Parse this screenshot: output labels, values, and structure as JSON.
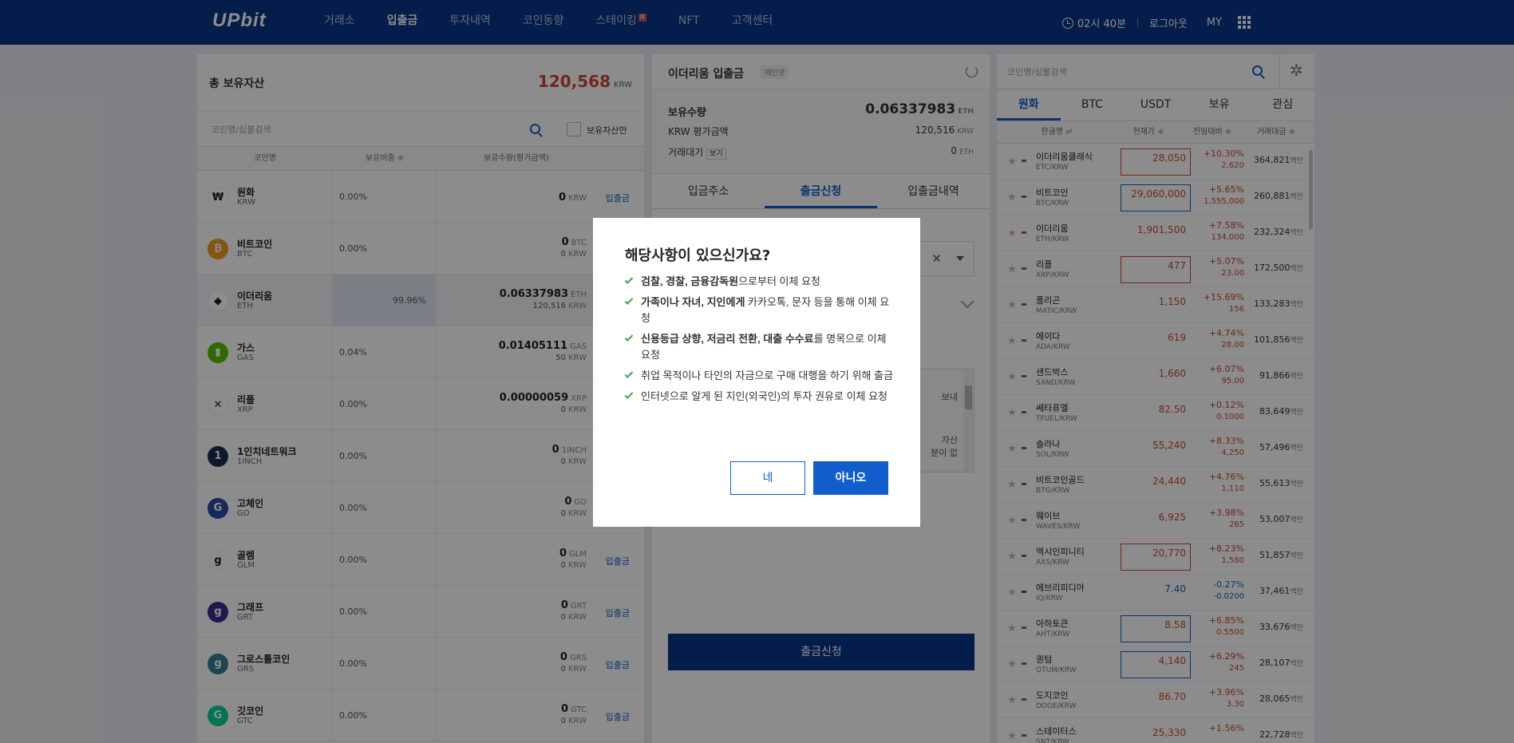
{
  "nav": {
    "logo": "UPbit",
    "menu": [
      "거래소",
      "입출금",
      "투자내역",
      "코인동향",
      "스테이킹",
      "NFT",
      "고객센터"
    ],
    "new_badge": "N",
    "time": "02시 40분",
    "logout": "로그아웃",
    "my": "MY"
  },
  "left": {
    "total_label": "총 보유자산",
    "total_value": "120,568",
    "total_unit": "KRW",
    "search_placeholder": "코인명/심볼검색",
    "only_held": "보유자산만",
    "headers": [
      "코인명",
      "보유비중 ≑",
      "보유수량(평가금액)"
    ],
    "rows": [
      {
        "name": "원화",
        "sym": "KRW",
        "pct": "0.00%",
        "amt": "0",
        "amt_unit": "KRW",
        "krw": "",
        "krw_unit": "",
        "action": "입출금",
        "icon": "won-icon",
        "color": "#ffffff",
        "glyph": "₩"
      },
      {
        "name": "비트코인",
        "sym": "BTC",
        "pct": "0.00%",
        "amt": "0",
        "amt_unit": "BTC",
        "krw": "0",
        "krw_unit": "KRW",
        "action": "",
        "icon": "bitcoin-icon",
        "color": "#f29a1f",
        "glyph": "₿"
      },
      {
        "name": "이더리움",
        "sym": "ETH",
        "pct": "99.96%",
        "pct_value": 99.96,
        "amt": "0.06337983",
        "amt_unit": "ETH",
        "krw": "120,516",
        "krw_unit": "KRW",
        "action": "",
        "icon": "ethereum-icon",
        "color": "#ffffff",
        "glyph": "◆"
      },
      {
        "name": "가스",
        "sym": "GAS",
        "pct": "0.04%",
        "amt": "0.01405111",
        "amt_unit": "GAS",
        "krw": "50",
        "krw_unit": "KRW",
        "action": "",
        "icon": "gas-icon",
        "color": "#58bf00",
        "glyph": "▮"
      },
      {
        "name": "리플",
        "sym": "XRP",
        "pct": "0.00%",
        "amt": "0.00000059",
        "amt_unit": "XRP",
        "krw": "0",
        "krw_unit": "KRW",
        "action": "",
        "icon": "xrp-icon",
        "color": "#ffffff",
        "glyph": "✕"
      },
      {
        "name": "1인치네트워크",
        "sym": "1INCH",
        "pct": "0.00%",
        "amt": "0",
        "amt_unit": "1INCH",
        "krw": "0",
        "krw_unit": "KRW",
        "action": "",
        "icon": "1inch-icon",
        "color": "#1b314f",
        "glyph": "1"
      },
      {
        "name": "고체인",
        "sym": "GO",
        "pct": "0.00%",
        "amt": "0",
        "amt_unit": "GO",
        "krw": "0",
        "krw_unit": "KRW",
        "action": "",
        "icon": "gochain-icon",
        "color": "#2c4aa6",
        "glyph": "G"
      },
      {
        "name": "골렘",
        "sym": "GLM",
        "pct": "0.00%",
        "amt": "0",
        "amt_unit": "GLM",
        "krw": "0",
        "krw_unit": "KRW",
        "action": "입출금",
        "icon": "golem-icon",
        "color": "#ffffff",
        "glyph": "g"
      },
      {
        "name": "그래프",
        "sym": "GRT",
        "pct": "0.00%",
        "amt": "0",
        "amt_unit": "GRT",
        "krw": "0",
        "krw_unit": "KRW",
        "action": "입출금",
        "icon": "graph-icon",
        "color": "#3c2c90",
        "glyph": "g"
      },
      {
        "name": "그로스톨코인",
        "sym": "GRS",
        "pct": "0.00%",
        "amt": "0",
        "amt_unit": "GRS",
        "krw": "0",
        "krw_unit": "KRW",
        "action": "입출금",
        "icon": "groestl-icon",
        "color": "#377e96",
        "glyph": "g"
      },
      {
        "name": "깃코인",
        "sym": "GTC",
        "pct": "0.00%",
        "amt": "0",
        "amt_unit": "GTC",
        "krw": "0",
        "krw_unit": "KRW",
        "action": "입출금",
        "icon": "gitcoin-icon",
        "color": "#02d396",
        "glyph": "G"
      }
    ]
  },
  "mid": {
    "title": "이더리움 입출금",
    "badge": "메인넷",
    "held_label": "보유수량",
    "held_value": "0.06337983",
    "held_unit": "ETH",
    "krw_label": "KRW 평가금액",
    "krw_value": "120,516",
    "krw_unit": "KRW",
    "pending_label": "거래대기",
    "view": "보기",
    "pending_value": "0",
    "pending_unit": "ETH",
    "tabs": [
      "입금주소",
      "출금신청",
      "입출금내역"
    ],
    "notice_frag1": "보내",
    "notice_frag2": "자산",
    "notice_frag3": "분이 없",
    "submit": "출금신청"
  },
  "right": {
    "search_placeholder": "코인명/심볼검색",
    "tabs": [
      "원화",
      "BTC",
      "USDT",
      "보유",
      "관심"
    ],
    "headers": [
      "한글명 ≓",
      "현재가 ≑",
      "전일대비 ≑",
      "거래대금 ≑"
    ],
    "rows": [
      {
        "name": "이더리움클래식",
        "sym": "ETC/KRW",
        "price": "28,050",
        "pct": "+10.30%",
        "diff": "2,620",
        "vol": "364,821",
        "dir": "up",
        "box": "up"
      },
      {
        "name": "비트코인",
        "sym": "BTC/KRW",
        "price": "29,060,000",
        "pct": "+5.65%",
        "diff": "1,555,000",
        "vol": "260,881",
        "dir": "up",
        "box": "dn"
      },
      {
        "name": "이더리움",
        "sym": "ETH/KRW",
        "price": "1,901,500",
        "pct": "+7.58%",
        "diff": "134,000",
        "vol": "232,324",
        "dir": "up",
        "box": ""
      },
      {
        "name": "리플",
        "sym": "XRP/KRW",
        "price": "477",
        "pct": "+5.07%",
        "diff": "23.00",
        "vol": "172,500",
        "dir": "up",
        "box": "up"
      },
      {
        "name": "폴리곤",
        "sym": "MATIC/KRW",
        "price": "1,150",
        "pct": "+15.69%",
        "diff": "156",
        "vol": "133,283",
        "dir": "up",
        "box": ""
      },
      {
        "name": "에이다",
        "sym": "ADA/KRW",
        "price": "619",
        "pct": "+4.74%",
        "diff": "28.00",
        "vol": "101,856",
        "dir": "up",
        "box": ""
      },
      {
        "name": "샌드박스",
        "sym": "SAND/KRW",
        "price": "1,660",
        "pct": "+6.07%",
        "diff": "95.00",
        "vol": "91,866",
        "dir": "up",
        "box": ""
      },
      {
        "name": "쎄타퓨엘",
        "sym": "TFUEL/KRW",
        "price": "82.50",
        "pct": "+0.12%",
        "diff": "0.1000",
        "vol": "83,649",
        "dir": "up",
        "box": ""
      },
      {
        "name": "솔라나",
        "sym": "SOL/KRW",
        "price": "55,240",
        "pct": "+8.33%",
        "diff": "4,250",
        "vol": "57,496",
        "dir": "up",
        "box": ""
      },
      {
        "name": "비트코인골드",
        "sym": "BTG/KRW",
        "price": "24,440",
        "pct": "+4.76%",
        "diff": "1,110",
        "vol": "55,613",
        "dir": "up",
        "box": ""
      },
      {
        "name": "웨이브",
        "sym": "WAVES/KRW",
        "price": "6,925",
        "pct": "+3.98%",
        "diff": "265",
        "vol": "53,007",
        "dir": "up",
        "box": ""
      },
      {
        "name": "엑시인피니티",
        "sym": "AXS/KRW",
        "price": "20,770",
        "pct": "+8.23%",
        "diff": "1,580",
        "vol": "51,857",
        "dir": "up",
        "box": "up"
      },
      {
        "name": "에브리피디아",
        "sym": "IQ/KRW",
        "price": "7.40",
        "pct": "-0.27%",
        "diff": "-0.0200",
        "vol": "37,461",
        "dir": "dn",
        "box": ""
      },
      {
        "name": "아하토큰",
        "sym": "AHT/KRW",
        "price": "8.58",
        "pct": "+6.85%",
        "diff": "0.5500",
        "vol": "33,676",
        "dir": "up",
        "box": "dn"
      },
      {
        "name": "퀀텀",
        "sym": "QTUM/KRW",
        "price": "4,140",
        "pct": "+6.29%",
        "diff": "245",
        "vol": "28,107",
        "dir": "up",
        "box": "dn"
      },
      {
        "name": "도지코인",
        "sym": "DOGE/KRW",
        "price": "86.70",
        "pct": "+3.96%",
        "diff": "3.30",
        "vol": "28,065",
        "dir": "up",
        "box": ""
      },
      {
        "name": "스테이터스",
        "sym": "SNT/KRW",
        "price": "25,330",
        "pct": "+1.56%",
        "diff": "",
        "vol": "22,728",
        "dir": "up",
        "box": ""
      }
    ],
    "vol_unit": "백만"
  },
  "modal": {
    "title": "해당사항이 있으신가요?",
    "items": [
      [
        {
          "b": "검찰, 경찰, 금융감독원"
        },
        {
          "t": "으로부터 이체 요청"
        }
      ],
      [
        {
          "b": "가족이나 자녀, 지인에게"
        },
        {
          "t": " 카카오톡, 문자 등을 통해 이체 요청"
        }
      ],
      [
        {
          "b": "신용등급 상향, 저금리 전환, 대출 수수료"
        },
        {
          "t": "를 명목으로 이체 요청"
        }
      ],
      [
        {
          "t": "취업 목적이나 타인의 자금으로 구매 대행을 하기 위해 출금"
        }
      ],
      [
        {
          "t": "인터넷으로 알게 된 지인(외국인)의 투자 권유로 이체 요청"
        }
      ]
    ],
    "yes": "네",
    "no": "아니오"
  },
  "colors": {
    "nav": "#093687",
    "accent": "#115dcb",
    "up": "#c84a31",
    "down": "#1261c4"
  }
}
